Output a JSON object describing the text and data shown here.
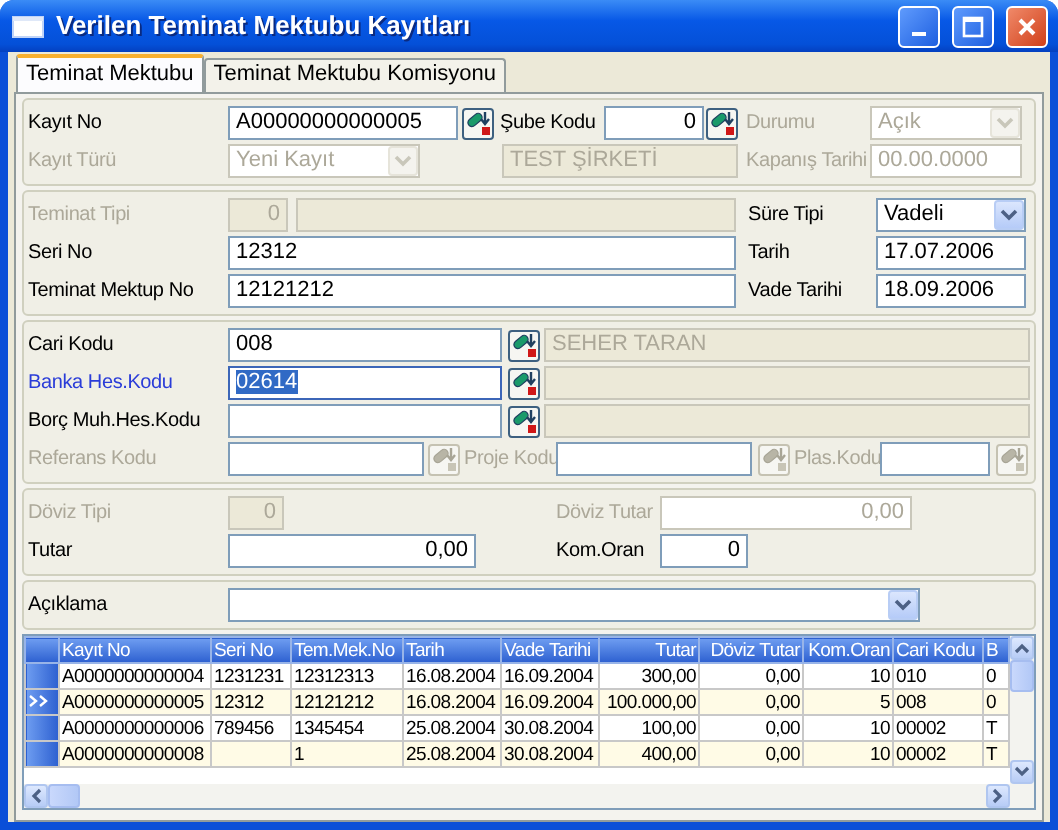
{
  "window": {
    "title": "Verilen Teminat Mektubu Kayıtları"
  },
  "tabs": [
    {
      "label": "Teminat Mektubu",
      "selected": true
    },
    {
      "label": "Teminat Mektubu Komisyonu",
      "selected": false
    }
  ],
  "panels": [
    {
      "rows": [
        {
          "items": [
            {
              "kind": "label",
              "text": "Kayıt No",
              "disabled": false,
              "focused": false
            },
            {
              "kind": "field",
              "value": "A00000000000005",
              "disabled": false,
              "focused": false
            },
            {
              "kind": "lookup",
              "disabled": false
            },
            {
              "kind": "label",
              "text": "Şube Kodu",
              "disabled": false,
              "focused": false
            },
            {
              "kind": "field",
              "value": "0",
              "disabled": false,
              "focused": false
            },
            {
              "kind": "lookup",
              "disabled": false
            },
            {
              "kind": "label",
              "text": "Durumu",
              "disabled": true,
              "focused": false
            },
            {
              "kind": "combo",
              "value": "Açık",
              "disabled": true
            }
          ]
        },
        {
          "items": [
            {
              "kind": "label",
              "text": "Kayıt Türü",
              "disabled": true,
              "focused": false
            },
            {
              "kind": "combo",
              "value": "Yeni Kayıt",
              "disabled": true
            },
            {
              "kind": "display",
              "value": "TEST ŞİRKETİ"
            },
            {
              "kind": "label",
              "text": "Kapanış Tarihi",
              "disabled": true,
              "focused": false
            },
            {
              "kind": "field",
              "value": "00.00.0000",
              "disabled": true,
              "focused": false
            }
          ]
        }
      ]
    },
    {
      "rows": [
        {
          "items": [
            {
              "kind": "label",
              "text": "Teminat Tipi",
              "disabled": true,
              "focused": false
            },
            {
              "kind": "display",
              "value": "0"
            },
            {
              "kind": "display"
            },
            {
              "kind": "label",
              "text": "Süre Tipi",
              "disabled": false,
              "focused": false
            },
            {
              "kind": "combo",
              "value": "Vadeli",
              "disabled": false
            }
          ]
        },
        {
          "items": [
            {
              "kind": "label",
              "text": "Seri No",
              "disabled": false,
              "focused": false
            },
            {
              "kind": "field",
              "value": "12312",
              "disabled": false,
              "focused": false
            },
            {
              "kind": "label",
              "text": "Tarih",
              "disabled": false,
              "focused": false
            },
            {
              "kind": "field",
              "value": "17.07.2006",
              "disabled": false,
              "focused": false
            }
          ]
        },
        {
          "items": [
            {
              "kind": "label",
              "text": "Teminat Mektup No",
              "disabled": false,
              "focused": false
            },
            {
              "kind": "field",
              "value": "12121212",
              "disabled": false,
              "focused": false
            },
            {
              "kind": "label",
              "text": "Vade Tarihi",
              "disabled": false,
              "focused": false
            },
            {
              "kind": "field",
              "value": "18.09.2006",
              "disabled": false,
              "focused": false
            }
          ]
        }
      ]
    },
    {
      "rows": [
        {
          "items": [
            {
              "kind": "label",
              "text": "Cari Kodu",
              "disabled": false,
              "focused": false
            },
            {
              "kind": "field",
              "value": "008",
              "disabled": false,
              "focused": false
            },
            {
              "kind": "lookup",
              "disabled": false
            },
            {
              "kind": "display",
              "value": "SEHER TARAN"
            }
          ]
        },
        {
          "items": [
            {
              "kind": "label",
              "text": "Banka Hes.Kodu",
              "disabled": false,
              "focused": true
            },
            {
              "kind": "field",
              "value": "02614",
              "disabled": false,
              "focused": true
            },
            {
              "kind": "lookup",
              "disabled": false
            },
            {
              "kind": "display"
            }
          ]
        },
        {
          "items": [
            {
              "kind": "label",
              "text": "Borç Muh.Hes.Kodu",
              "disabled": false,
              "focused": false
            },
            {
              "kind": "field",
              "disabled": false,
              "focused": false
            },
            {
              "kind": "lookup",
              "disabled": false
            },
            {
              "kind": "display"
            }
          ]
        },
        {
          "items": [
            {
              "kind": "label",
              "text": "Referans Kodu",
              "disabled": true,
              "focused": false
            },
            {
              "kind": "field",
              "disabled": false,
              "focused": false
            },
            {
              "kind": "lookup",
              "disabled": true
            },
            {
              "kind": "label",
              "text": "Proje Kodu",
              "disabled": true,
              "focused": false
            },
            {
              "kind": "field",
              "disabled": false,
              "focused": false
            },
            {
              "kind": "lookup",
              "disabled": true
            },
            {
              "kind": "label",
              "text": "Plas.Kodu",
              "disabled": true,
              "focused": false
            },
            {
              "kind": "field",
              "disabled": false,
              "focused": false
            },
            {
              "kind": "lookup",
              "disabled": true
            }
          ]
        }
      ]
    },
    {
      "rows": [
        {
          "items": [
            {
              "kind": "label",
              "text": "Döviz Tipi",
              "disabled": true,
              "focused": false
            },
            {
              "kind": "display",
              "value": "0"
            },
            {
              "kind": "label",
              "text": "Döviz Tutar",
              "disabled": true,
              "focused": false
            },
            {
              "kind": "field",
              "value": "0,00",
              "disabled": true,
              "focused": false
            }
          ]
        },
        {
          "items": [
            {
              "kind": "label",
              "text": "Tutar",
              "disabled": false,
              "focused": false
            },
            {
              "kind": "field",
              "value": "0,00",
              "disabled": false,
              "focused": false
            },
            {
              "kind": "label",
              "text": "Kom.Oran",
              "disabled": false,
              "focused": false
            },
            {
              "kind": "field",
              "value": "0",
              "disabled": false,
              "focused": false
            }
          ]
        }
      ]
    },
    {
      "rows": [
        {
          "items": [
            {
              "kind": "label",
              "text": "Açıklama",
              "disabled": false,
              "focused": false
            },
            {
              "kind": "combo",
              "disabled": false
            }
          ]
        }
      ]
    }
  ],
  "grid": {
    "columns": [
      "Kayıt No",
      "Seri No",
      "Tem.Mek.No",
      "Tarih",
      "Vade Tarihi",
      "Tutar",
      "Döviz Tutar",
      "Kom.Oran",
      "Cari Kodu",
      "B"
    ],
    "rows": [
      {
        "selected": false,
        "cells": [
          "A0000000000004",
          "1231231",
          "12312313",
          "16.08.2004",
          "16.09.2004",
          "300,00",
          "0,00",
          "10",
          "010",
          "0"
        ]
      },
      {
        "selected": true,
        "cells": [
          "A0000000000005",
          "12312",
          "12121212",
          "16.08.2004",
          "16.09.2004",
          "100.000,00",
          "0,00",
          "5",
          "008",
          "0"
        ]
      },
      {
        "selected": false,
        "cells": [
          "A0000000000006",
          "789456",
          "1345454",
          "25.08.2004",
          "30.08.2004",
          "100,00",
          "0,00",
          "10",
          "00002",
          "T"
        ]
      },
      {
        "selected": false,
        "cells": [
          "A0000000000008",
          "",
          "1",
          "25.08.2004",
          "30.08.2004",
          "400,00",
          "0,00",
          "10",
          "00002",
          "T"
        ]
      }
    ]
  }
}
